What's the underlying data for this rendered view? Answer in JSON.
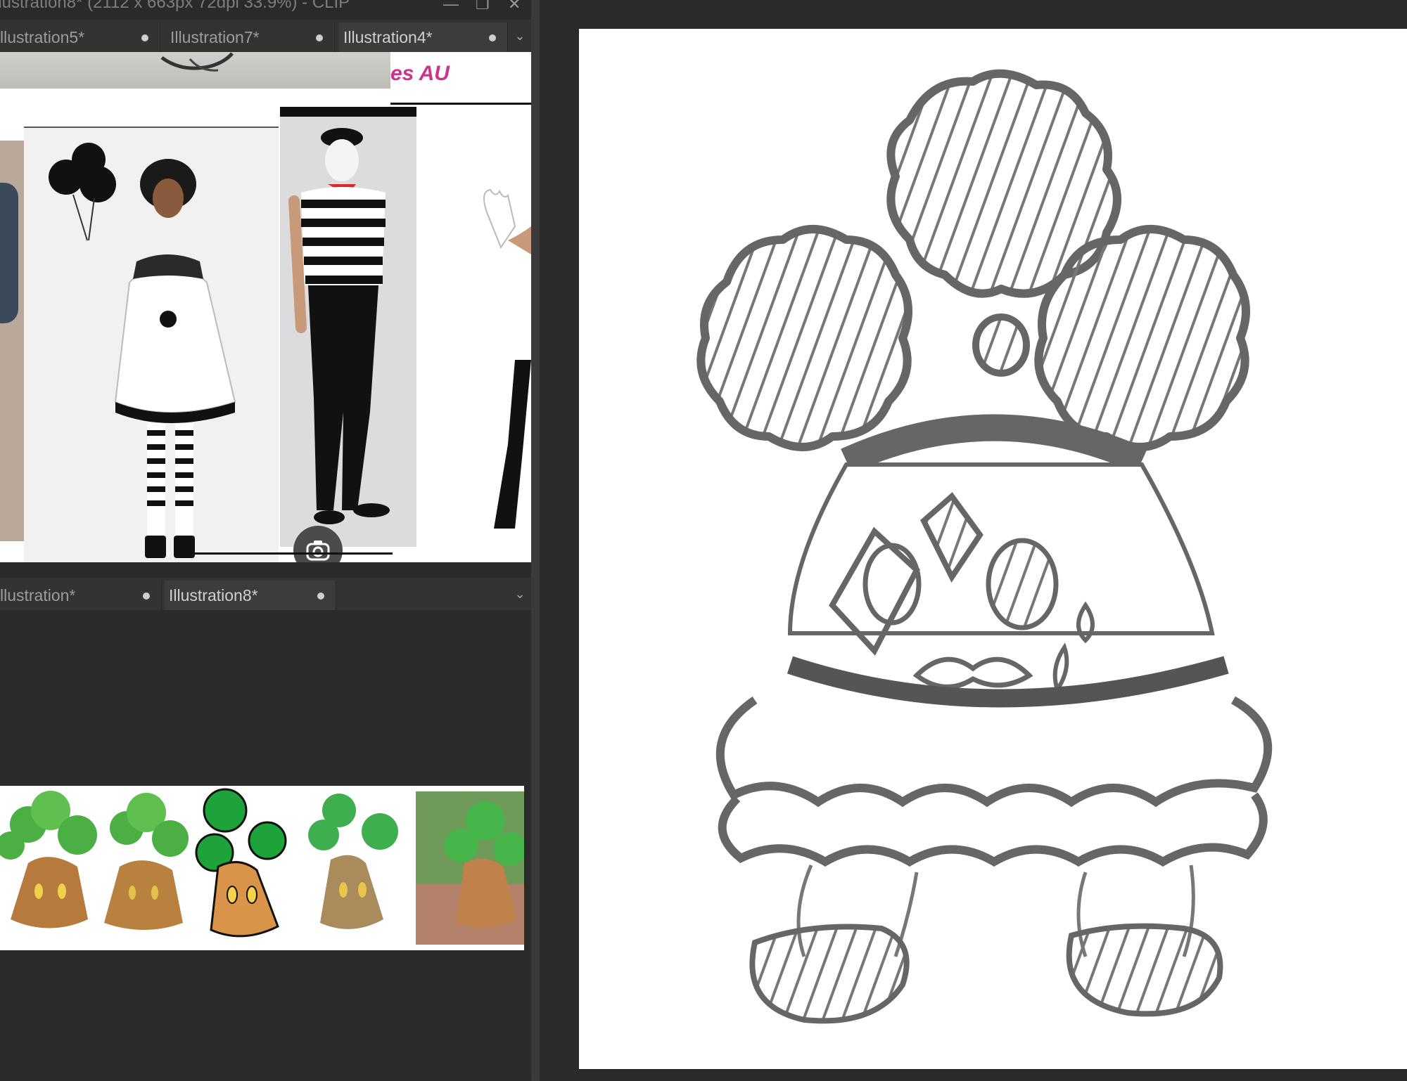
{
  "window": {
    "title": "llustration8* (2112 x 663px 72dpi 33.9%) - CLIP",
    "min_glyph": "—",
    "max_glyph": "❐",
    "close_glyph": "✕"
  },
  "panel_top": {
    "tabs": [
      {
        "label": "llustration5*"
      },
      {
        "label": "Illustration7*"
      },
      {
        "label": "Illustration4*"
      }
    ],
    "logo_text": "es AU"
  },
  "panel_bottom": {
    "tabs": [
      {
        "label": "llustration*"
      },
      {
        "label": "Illustration8*"
      }
    ]
  },
  "colors": {
    "app_bg": "#2a2a2a",
    "tabbar_bg": "#333333",
    "active_tab_bg": "#3c3c3c",
    "sketch_stroke": "#666666",
    "bonsly_green": "#3aa83a",
    "bonsly_brown": "#b57a3c"
  },
  "icons": {
    "camera": "camera-search-icon",
    "chevron": "chevron-down-icon",
    "dot": "unsaved-dot-icon"
  }
}
